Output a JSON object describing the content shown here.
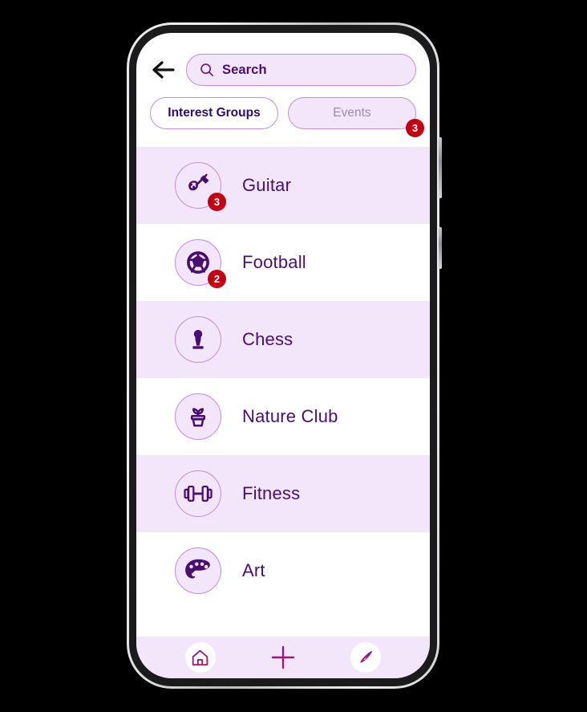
{
  "app": {
    "accent_purple": "#4a0d70",
    "accent_light_lavender": "#f3e5fa",
    "accent_row_shade": "#f3e6fb",
    "badge_red": "#c00014",
    "border_purple": "#c28fd6"
  },
  "header": {
    "back_icon": "arrow-left-icon",
    "search": {
      "icon": "search-icon",
      "placeholder": "Search",
      "value": ""
    }
  },
  "tabs": [
    {
      "label": "Interest Groups",
      "active": true,
      "badge": null
    },
    {
      "label": "Events",
      "active": false,
      "badge": "3"
    }
  ],
  "groups": [
    {
      "label": "Guitar",
      "icon": "guitar-icon",
      "badge": "3",
      "shade": "a"
    },
    {
      "label": "Football",
      "icon": "football-icon",
      "badge": "2",
      "shade": "b"
    },
    {
      "label": "Chess",
      "icon": "chess-pawn-icon",
      "badge": null,
      "shade": "a"
    },
    {
      "label": "Nature Club",
      "icon": "potted-plant-icon",
      "badge": null,
      "shade": "b"
    },
    {
      "label": "Fitness",
      "icon": "dumbbell-icon",
      "badge": null,
      "shade": "a"
    },
    {
      "label": "Art",
      "icon": "palette-icon",
      "badge": null,
      "shade": "b"
    }
  ],
  "bottom_nav": [
    {
      "name": "home",
      "icon": "home-icon"
    },
    {
      "name": "add",
      "icon": "plus-icon"
    },
    {
      "name": "explore",
      "icon": "compass-icon"
    }
  ]
}
